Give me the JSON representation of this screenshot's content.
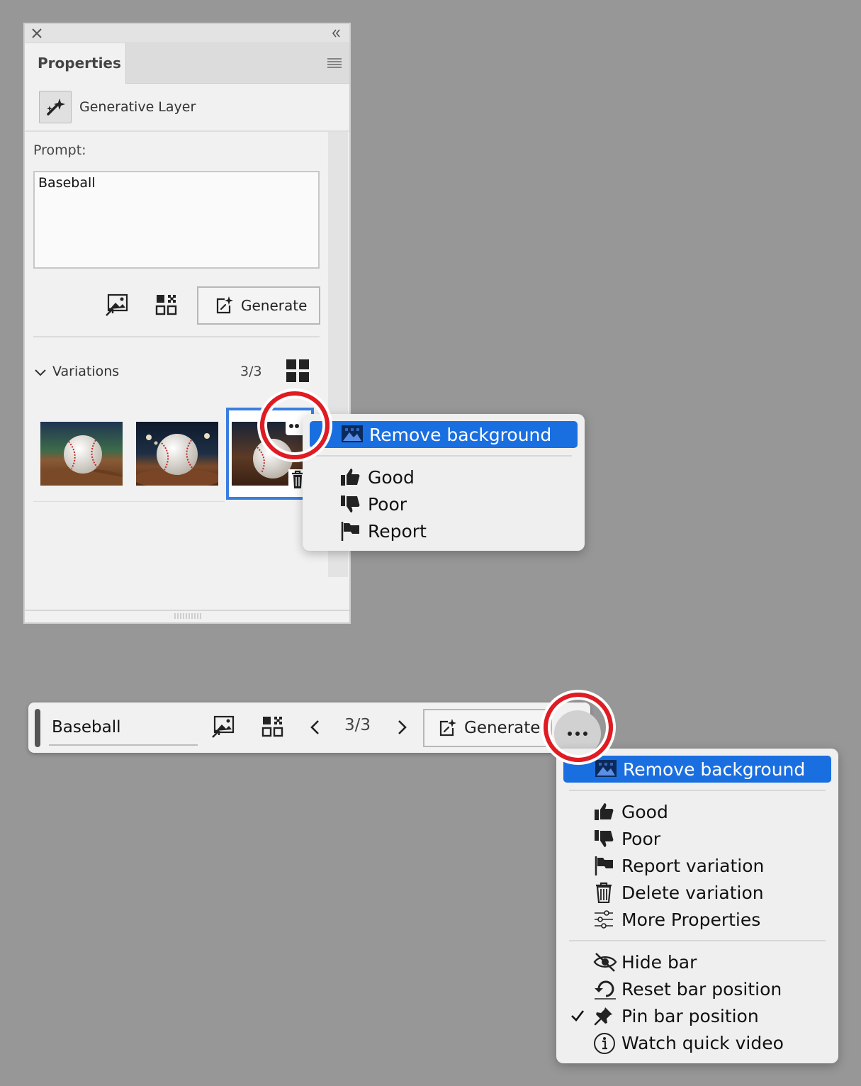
{
  "panel": {
    "tab_title": "Properties",
    "layer_type": "Generative Layer",
    "prompt_label": "Prompt:",
    "prompt_value": "Baseball",
    "generate_label": "Generate",
    "variations_label": "Variations",
    "variations_count": "3/3"
  },
  "panel_menu": {
    "remove_background": "Remove background",
    "good": "Good",
    "poor": "Poor",
    "report": "Report"
  },
  "taskbar": {
    "prompt_value": "Baseball",
    "count": "3/3",
    "generate_label": "Generate"
  },
  "taskbar_menu": {
    "remove_background": "Remove background",
    "good": "Good",
    "poor": "Poor",
    "report_variation": "Report variation",
    "delete_variation": "Delete variation",
    "more_properties": "More Properties",
    "hide_bar": "Hide bar",
    "reset_bar_position": "Reset bar position",
    "pin_bar_position": "Pin bar position",
    "watch_quick_video": "Watch quick video",
    "pin_checked": true
  },
  "colors": {
    "highlight": "#1a6fe0",
    "callout": "#e01b22",
    "selection": "#3a7ee0"
  }
}
